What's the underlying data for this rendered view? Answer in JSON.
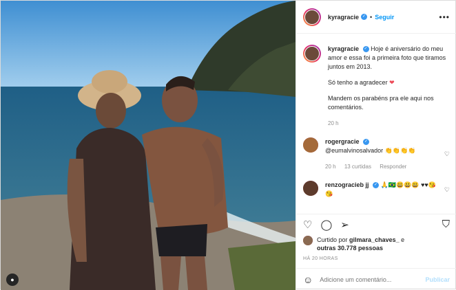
{
  "header": {
    "username": "kyragracie",
    "follow": "Seguir",
    "dot": "•",
    "more": "•••"
  },
  "caption": {
    "username": "kyragracie",
    "line1": "Hoje é aniversário do meu amor e essa foi a primeira foto que tiramos juntos em 2013.",
    "line2": "Só tenho a agradecer",
    "line3": "Mandem os parabéns pra ele aqui nos comentários.",
    "time": "20 h"
  },
  "comments": [
    {
      "username": "rogergracie",
      "text": "@eumalvinosalvador 👏👏👏👏",
      "time": "20 h",
      "likes": "13 curtidas",
      "reply": "Responder"
    },
    {
      "username": "renzogracieb jj",
      "text": "🙏🇧🇷😃😃😃 ♥♥😘😘"
    }
  ],
  "likes": {
    "prefix": "Curtido por",
    "user": "gilmara_chaves_",
    "mid": "e",
    "others": "outras 30.778 pessoas"
  },
  "posted": "HÁ 20 HORAS",
  "add_comment": {
    "placeholder": "Adicione um comentário...",
    "publish": "Publicar"
  }
}
